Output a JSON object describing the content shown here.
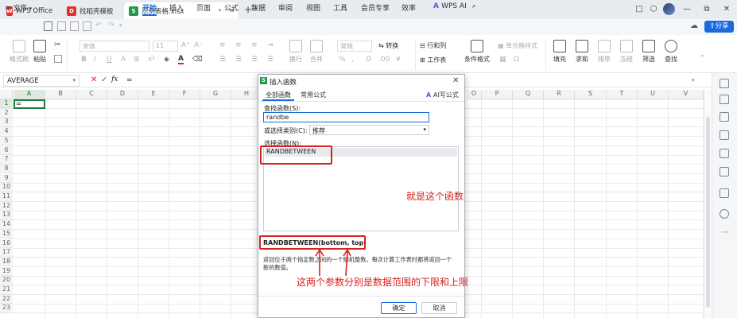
{
  "titlebar": {
    "tabs": [
      {
        "label": "WPS Office",
        "icon": "wps-logo-icon"
      },
      {
        "label": "找稻壳模板",
        "icon": "docer-icon"
      },
      {
        "label": "示例表格.xlsx",
        "icon": "spreadsheet-s-icon"
      }
    ],
    "new_tab": "+",
    "controls": [
      "□",
      "⬡",
      "—",
      "⧉",
      "✕"
    ]
  },
  "menubar": {
    "file": "文件",
    "items": [
      "开始",
      "插入",
      "页面",
      "公式",
      "数据",
      "审阅",
      "视图",
      "工具",
      "会员专享",
      "效率"
    ],
    "wps_ai": "WPS AI",
    "share": "分享"
  },
  "ribbon": {
    "format_painter": "格式刷",
    "paste": "粘贴",
    "font": "宋体",
    "font_size": "11",
    "number_format": "常规",
    "convert": "转换",
    "wrap": "换行",
    "merge": "合并",
    "row_col": "行和列",
    "worksheet": "工作表",
    "cond_format": "条件格式",
    "cell_style": "单元格样式",
    "fill": "填充",
    "sum": "求和",
    "sort": "排序",
    "freeze": "冻结",
    "filter": "筛选",
    "find": "查找"
  },
  "formulabar": {
    "name_box": "AVERAGE",
    "content": "="
  },
  "grid": {
    "columns": [
      "A",
      "B",
      "C",
      "D",
      "E",
      "F",
      "G",
      "H",
      "I",
      "O",
      "P",
      "Q",
      "R",
      "S",
      "T",
      "U",
      "V"
    ],
    "rows": [
      "1",
      "2",
      "3",
      "4",
      "5",
      "6",
      "7",
      "8",
      "9",
      "10",
      "11",
      "12",
      "13",
      "14",
      "15",
      "16",
      "17",
      "18",
      "19",
      "20",
      "21",
      "22",
      "23"
    ],
    "a1_value": "="
  },
  "dialog": {
    "title": "插入函数",
    "tabs": [
      "全部函数",
      "常用公式"
    ],
    "ai_formula": "AI写公式",
    "search_label": "查找函数(S):",
    "search_value": "randbe",
    "category_label": "或选择类别(C):",
    "category_value": "推荐",
    "select_label": "选择函数(N):",
    "list": [
      "RANDBETWEEN"
    ],
    "signature": "RANDBETWEEN(bottom, top)",
    "description_line1": "返回位于两个指定数之间的一个随机整数。每次计算工作表时都将返回一个",
    "description_line2": "新的数值。",
    "ok": "确定",
    "cancel": "取消"
  },
  "annotations": {
    "note1": "就是这个函数",
    "note2": "这两个参数分别是数据范围的下限和上限"
  },
  "colors": {
    "accent": "#1a6cdc",
    "annotation": "#d7221d",
    "selected_cell": "#1e7a3a"
  }
}
